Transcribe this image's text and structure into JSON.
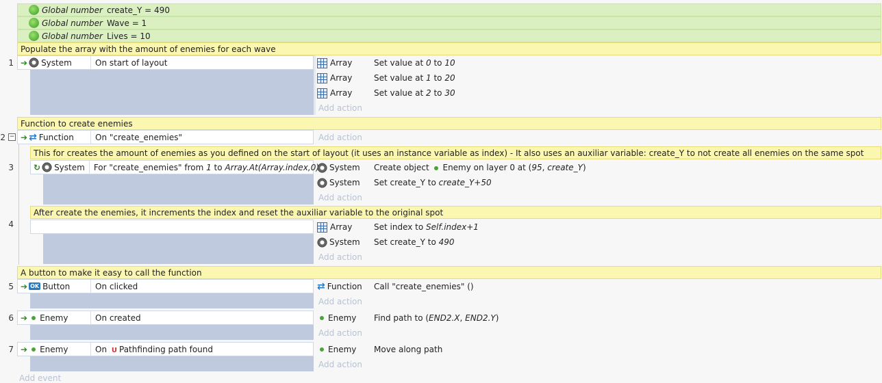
{
  "globals": [
    {
      "kind": "Global number",
      "text": "create_Y = 490"
    },
    {
      "kind": "Global number",
      "text": "Wave = 1"
    },
    {
      "kind": "Global number",
      "text": "Lives = 10"
    }
  ],
  "comments": [
    "Populate the array with the amount of enemies for each wave",
    "Function to create enemies",
    "This for creates the amount of enemies as you defined on the start of layout (it uses an instance variable as index) - It also uses an auxiliar variable: create_Y to not create all enemies on the same spot",
    "After create the enemies, it increments the index and reset the auxiliar variable to the original spot",
    "A button to make it easy to call the function"
  ],
  "events": [
    {
      "num": "1",
      "obj": "System",
      "cond": "On start of layout"
    },
    {
      "num": "2",
      "obj": "Function",
      "cond": "On \"create_enemies\""
    },
    {
      "num": "3",
      "obj": "System",
      "cond_a": "For \"create_enemies\" from ",
      "cond_b": "1",
      "cond_c": " to ",
      "cond_d": "Array.At(Array.index,0)"
    },
    {
      "num": "4"
    },
    {
      "num": "5",
      "obj": "Button",
      "cond": "On clicked"
    },
    {
      "num": "6",
      "obj": "Enemy",
      "cond": "On created"
    },
    {
      "num": "7",
      "obj": "Enemy",
      "cond_a": "On ",
      "cond_b": "Pathfinding path found"
    }
  ],
  "actions": {
    "e1": [
      {
        "obj": "Array",
        "a": "Set value at ",
        "b": "0",
        "c": " to ",
        "d": "10"
      },
      {
        "obj": "Array",
        "a": "Set value at ",
        "b": "1",
        "c": " to ",
        "d": "20"
      },
      {
        "obj": "Array",
        "a": "Set value at ",
        "b": "2",
        "c": " to ",
        "d": "30"
      }
    ],
    "e3": [
      {
        "obj": "System",
        "a": "Create object ",
        "b": "Enemy on layer 0 at (",
        "c": "95",
        "d": ", ",
        "e": "create_Y",
        "f": ")"
      },
      {
        "obj": "System",
        "a": "Set create_Y to ",
        "b": "create_Y+50"
      }
    ],
    "e4": [
      {
        "obj": "Array",
        "a": "Set index to ",
        "b": "Self.index+1"
      },
      {
        "obj": "System",
        "a": "Set create_Y to ",
        "b": "490"
      }
    ],
    "e5": [
      {
        "obj": "Function",
        "a": "Call \"create_enemies\" ()"
      }
    ],
    "e6": [
      {
        "obj": "Enemy",
        "a": "Find path to (",
        "b": "END2.X",
        "c": ", ",
        "d": "END2.Y",
        "e": ")"
      }
    ],
    "e7": [
      {
        "obj": "Enemy",
        "a": "Move along path"
      }
    ]
  },
  "add_action": "Add action",
  "add_event": "Add event",
  "ok_badge": "OK",
  "pf_badge": "U",
  "collapse_symbol": "−"
}
